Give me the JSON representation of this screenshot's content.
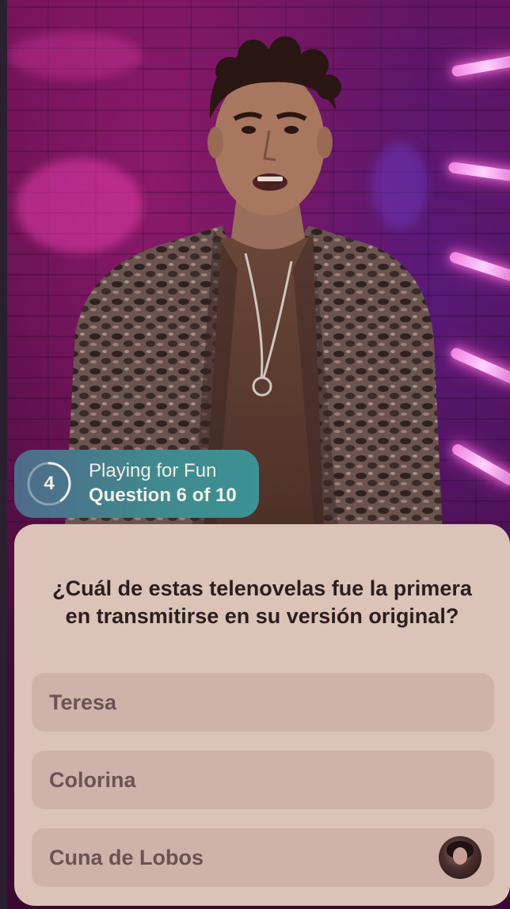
{
  "hud": {
    "timer_value": "4",
    "timer_progress": 0.4,
    "mode_label": "Playing for Fun",
    "progress_label": "Question 6 of 10"
  },
  "quiz": {
    "question": "¿Cuál de estas telenovelas fue la primera en transmitirse en su versión original?",
    "options": [
      {
        "label": "Teresa"
      },
      {
        "label": "Colorina"
      },
      {
        "label": "Cuna de Lobos",
        "has_player_avatar": true
      }
    ]
  },
  "colors": {
    "card_background": "#dcc3b7",
    "option_background": "#cfb2aa",
    "hud_gradient_start": "#4f6b8a",
    "hud_gradient_end": "#3c9294",
    "video_tint": "#6a1050"
  }
}
